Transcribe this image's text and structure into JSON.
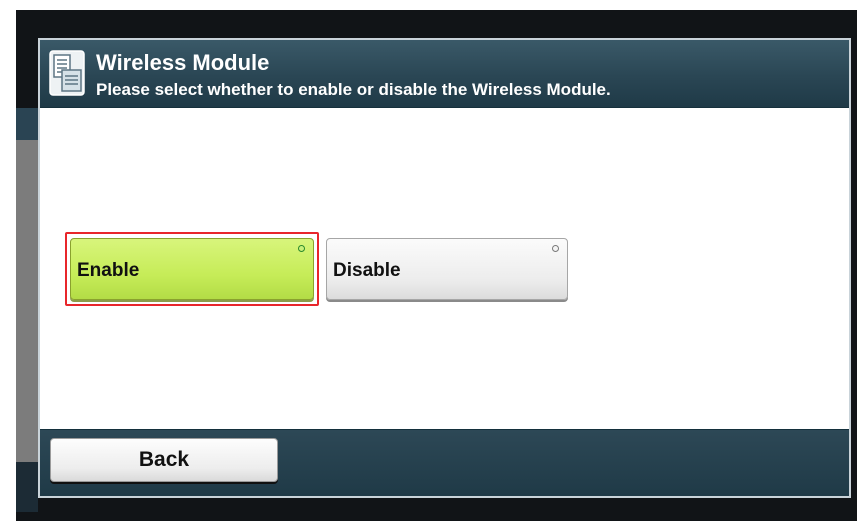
{
  "header": {
    "title": "Wireless Module",
    "subtitle": "Please select whether to enable or disable the Wireless Module.",
    "icon": "document-settings-icon"
  },
  "options": [
    {
      "label": "Enable",
      "selected": true,
      "indicator_color": "#2b8a2b"
    },
    {
      "label": "Disable",
      "selected": false,
      "indicator_color": "#7a7a7a"
    }
  ],
  "footer": {
    "back_label": "Back"
  },
  "colors": {
    "header_bg": "#2a4654",
    "selected_bg": "#c6ec58",
    "highlight": "#e8262b"
  }
}
